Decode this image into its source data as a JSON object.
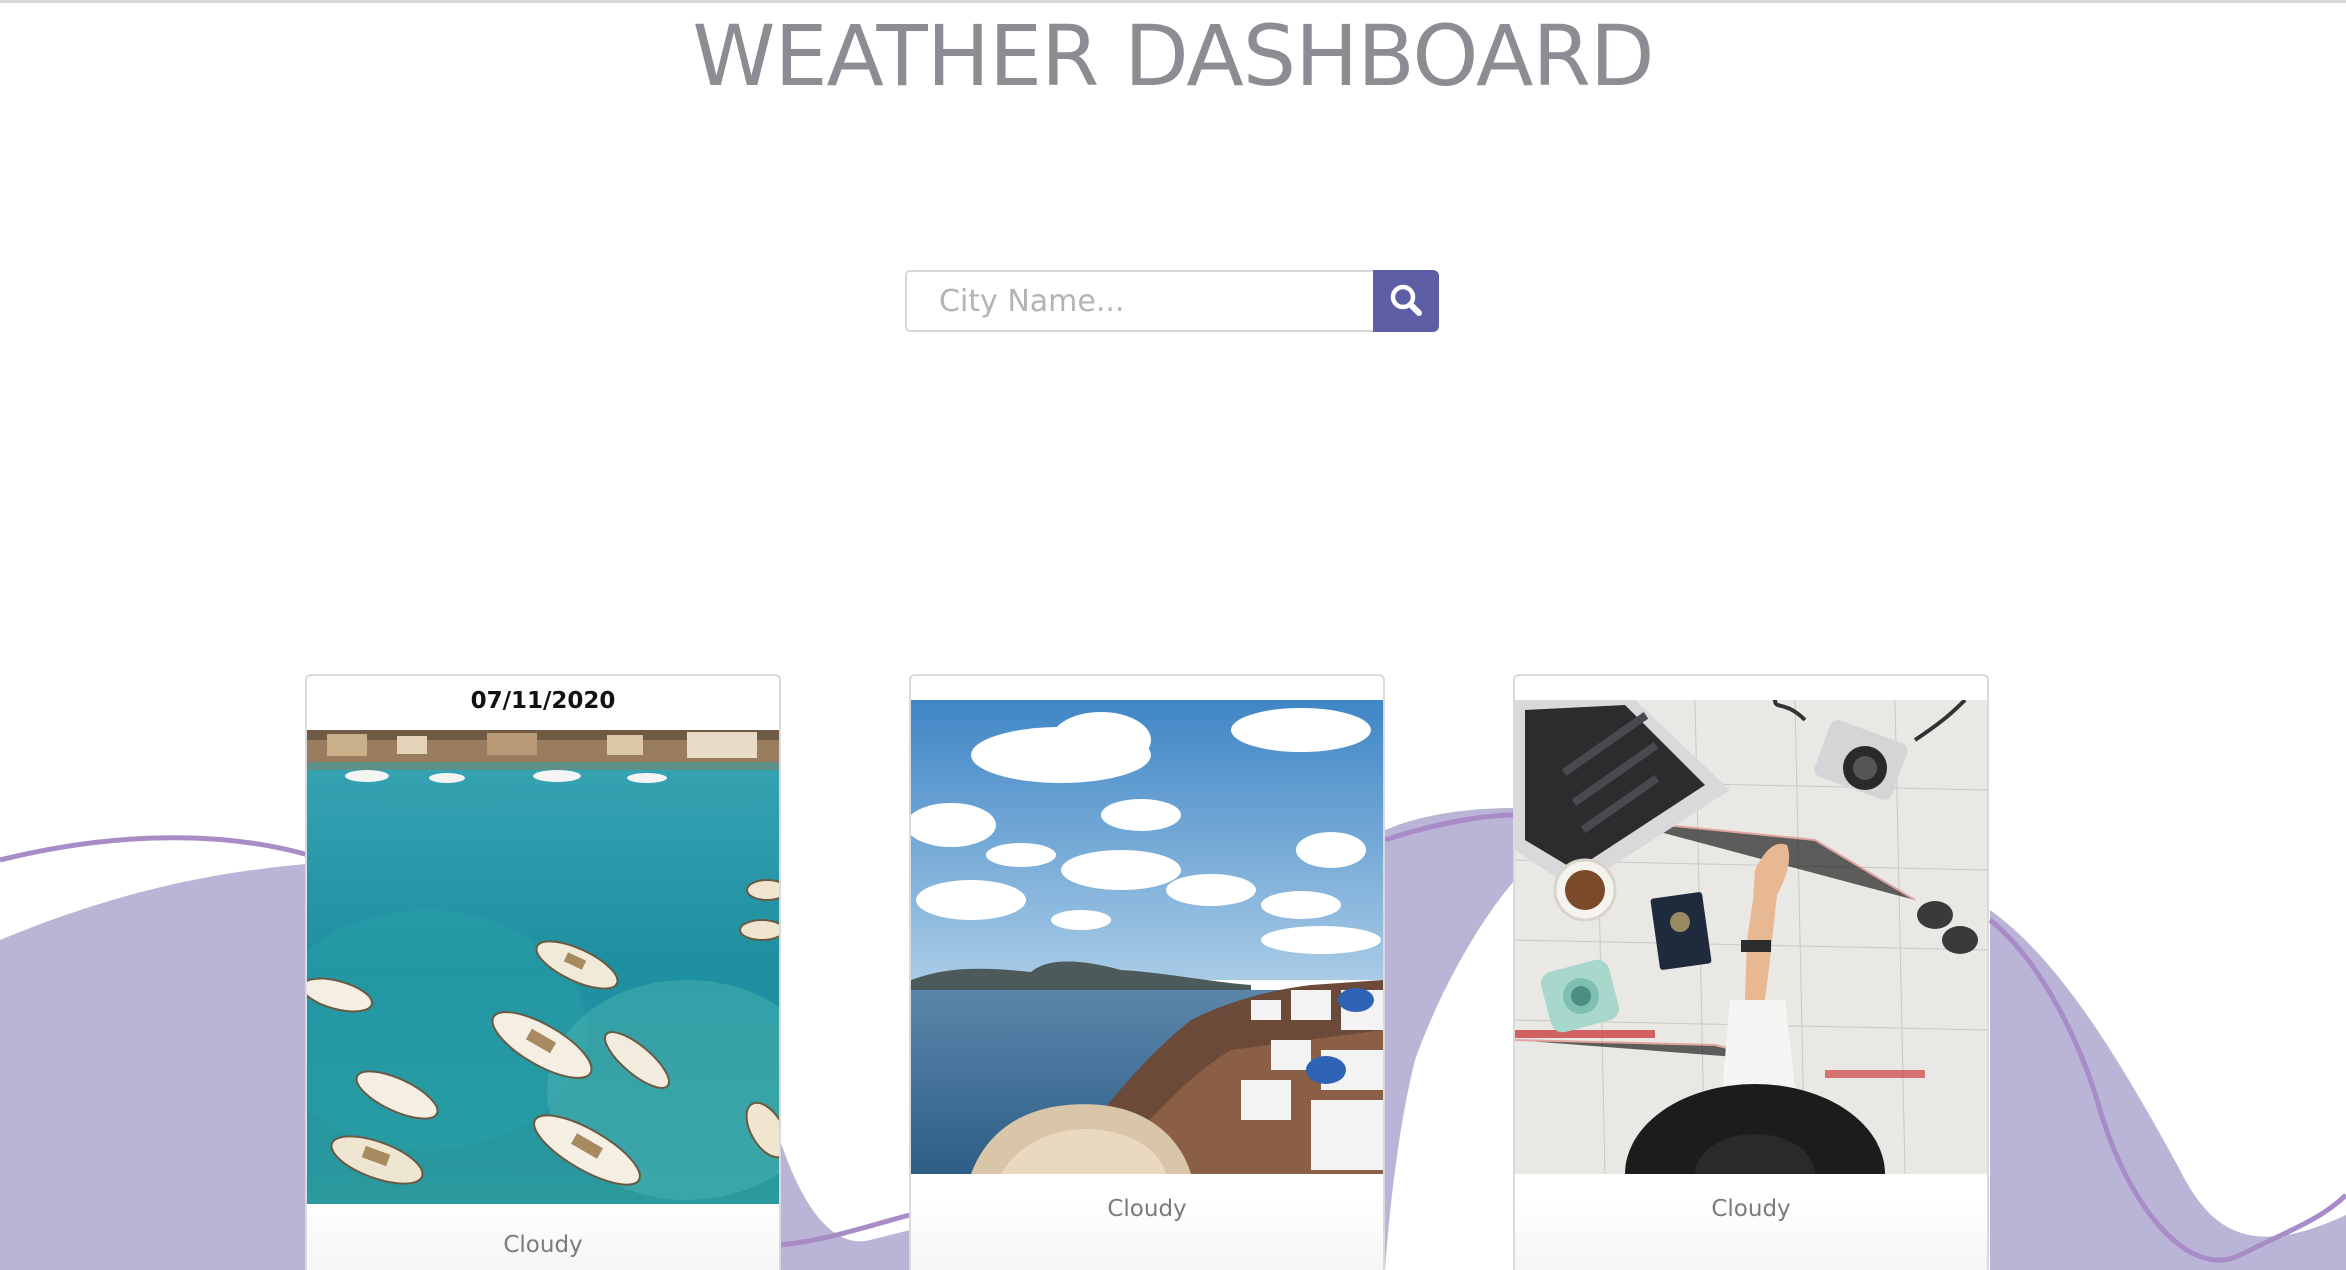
{
  "header": {
    "title": "WEATHER DASHBOARD"
  },
  "search": {
    "placeholder": "City Name...",
    "button_icon": "search-icon"
  },
  "colors": {
    "accent": "#5d5ea3",
    "wave_fill": "#bab5d6",
    "wave_line": "#a98cc7",
    "title_text": "#8b8d92"
  },
  "cards": [
    {
      "date": "07/11/2020",
      "image": "harbor-boats-photo",
      "condition": "Cloudy"
    },
    {
      "date": "",
      "image": "coastal-town-sky-photo",
      "condition": "Cloudy"
    },
    {
      "date": "",
      "image": "travel-map-flatlay-photo",
      "condition": "Cloudy"
    }
  ]
}
